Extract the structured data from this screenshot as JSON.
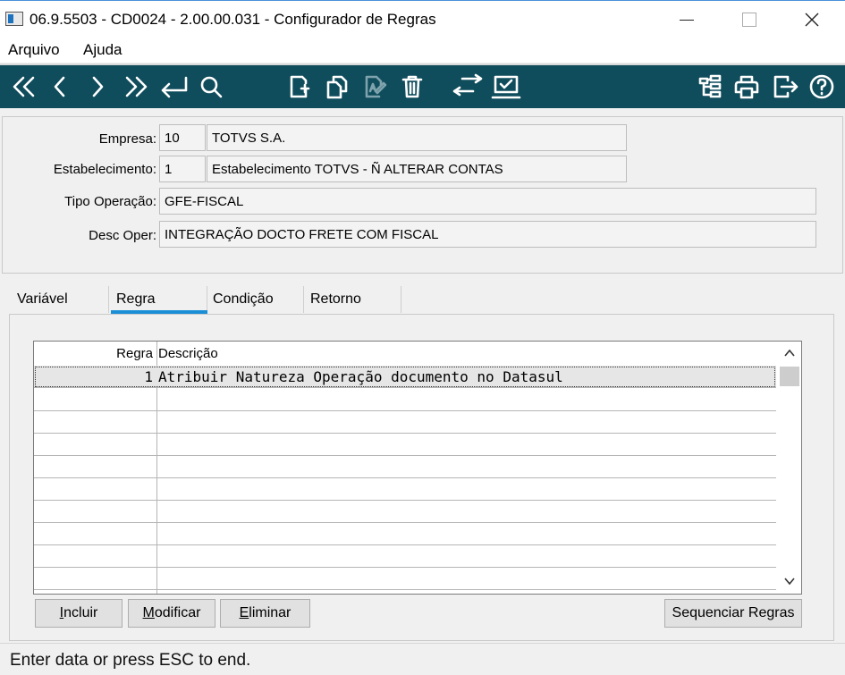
{
  "window": {
    "title": "06.9.5503 - CD0024 - 2.00.00.031 - Configurador de Regras"
  },
  "menu": {
    "items": [
      "Arquivo",
      "Ajuda"
    ]
  },
  "toolbar": {
    "nav": [
      "first-icon",
      "previous-icon",
      "next-icon",
      "last-icon",
      "goto-icon",
      "search-icon"
    ],
    "edit": [
      "new-record-icon",
      "copy-record-icon",
      "edit-record-icon",
      "delete-icon"
    ],
    "other": [
      "swap-icon",
      "confirm-icon"
    ],
    "right": [
      "tree-icon",
      "print-icon",
      "exit-icon",
      "help-icon"
    ]
  },
  "header": {
    "empresa_label": "Empresa:",
    "empresa_code": "10",
    "empresa_name": "TOTVS S.A.",
    "estab_label": "Estabelecimento:",
    "estab_code": "1",
    "estab_name": "Estabelecimento TOTVS - Ñ ALTERAR CONTAS",
    "tipo_label": "Tipo Operação:",
    "tipo_value": "GFE-FISCAL",
    "desc_label": "Desc Oper:",
    "desc_value": "INTEGRAÇÃO DOCTO FRETE COM FISCAL"
  },
  "tabs": [
    "Variável",
    "Regra",
    "Condição",
    "Retorno"
  ],
  "active_tab": "Regra",
  "grid": {
    "columns": [
      "Regra",
      "Descrição"
    ],
    "rows": [
      {
        "regra": "1",
        "descricao": "Atribuir Natureza Operação documento no Datasul"
      }
    ]
  },
  "buttons": {
    "incluir": {
      "first": "I",
      "rest": "ncluir"
    },
    "modificar": {
      "first": "M",
      "rest": "odificar"
    },
    "eliminar": {
      "first": "E",
      "rest": "liminar"
    },
    "sequenciar": "Sequenciar Regras"
  },
  "status": {
    "text": "Enter data or press ESC to end."
  },
  "colors": {
    "toolbar_bg": "#0f4c5c",
    "tab_accent": "#1a8fd6"
  }
}
